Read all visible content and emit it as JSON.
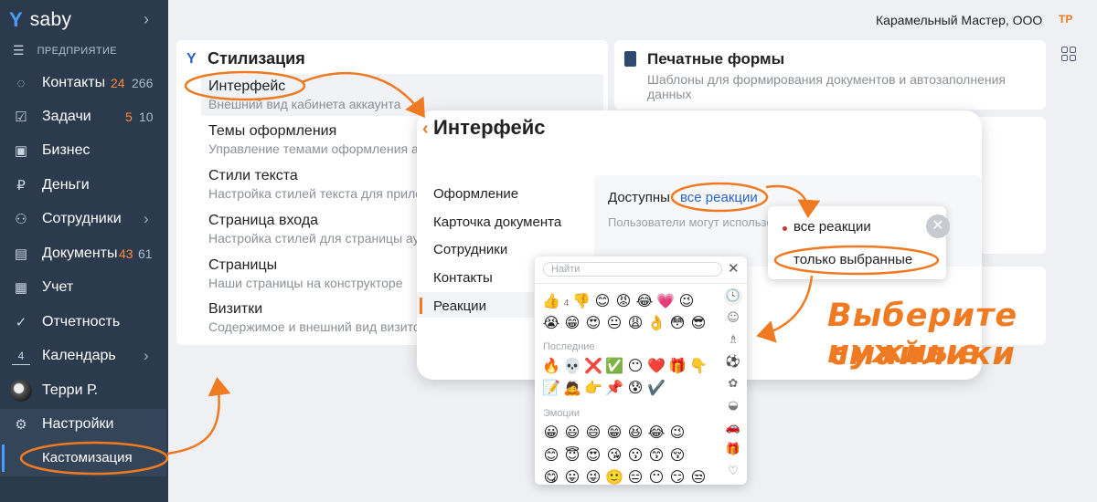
{
  "sidebar": {
    "logo": "saby",
    "section": "ПРЕДПРИЯТИЕ",
    "items": [
      {
        "icon": "contacts-icon",
        "label": "Контакты",
        "count1": "24",
        "count2": "266"
      },
      {
        "icon": "tasks-icon",
        "label": "Задачи",
        "count1": "5",
        "count2": "10"
      },
      {
        "icon": "business-icon",
        "label": "Бизнес"
      },
      {
        "icon": "money-icon",
        "label": "Деньги"
      },
      {
        "icon": "employees-icon",
        "label": "Сотрудники"
      },
      {
        "icon": "documents-icon",
        "label": "Документы",
        "count1": "43",
        "count2": "61"
      },
      {
        "icon": "accounting-icon",
        "label": "Учет"
      },
      {
        "icon": "reports-icon",
        "label": "Отчетность"
      },
      {
        "icon": "calendar-icon",
        "label": "Календарь",
        "day": "4"
      },
      {
        "icon": "avatar",
        "label": "Терри Р."
      },
      {
        "icon": "gear-icon",
        "label": "Настройки"
      }
    ],
    "sub_item": "Кастомизация"
  },
  "header": {
    "company": "Карамельный Мастер, ООО",
    "user_initials": "ТР"
  },
  "styling": {
    "title": "Стилизация",
    "items": [
      {
        "name": "Интерфейс",
        "desc": "Внешний вид кабинета аккаунта"
      },
      {
        "name": "Темы оформления",
        "desc": "Управление темами оформления аккаунта"
      },
      {
        "name": "Стили текста",
        "desc": "Настройка стилей текста для приложений"
      },
      {
        "name": "Страница входа",
        "desc": "Настройка стилей для страницы аутентификации"
      },
      {
        "name": "Страницы",
        "desc": "Наши страницы на конструкторе"
      },
      {
        "name": "Визитки",
        "desc": "Содержимое и внешний вид визиток"
      }
    ]
  },
  "print_forms": {
    "title": "Печатные формы",
    "desc": "Шаблоны для формирования документов и автозаполнения данных"
  },
  "interface_panel": {
    "title": "Интерфейс",
    "nav": [
      "Оформление",
      "Карточка документа",
      "Сотрудники",
      "Контакты",
      "Реакции"
    ],
    "available_label": "Доступны",
    "available_value": "все реакции",
    "users_text": "Пользователи могут использовать"
  },
  "dropdown": {
    "options": [
      "все реакции",
      "только выбранные"
    ]
  },
  "emoji_picker": {
    "search_placeholder": "Найти",
    "top_count": "4",
    "top_rows": [
      [
        "👍",
        "",
        "👎",
        "😊",
        "😡",
        "😂",
        "💗",
        "😉"
      ],
      [
        "😭",
        "😁",
        "😍",
        "😐",
        "😩",
        "👌",
        "😳",
        "😎"
      ]
    ],
    "recent_label": "Последние",
    "recent_rows": [
      [
        "🔥",
        "💀",
        "❌",
        "✅",
        "😶",
        "❤️",
        "🎁",
        "👇"
      ],
      [
        "📝",
        "🙇",
        "👉",
        "📌",
        "😰",
        "✔️"
      ]
    ],
    "emotions_label": "Эмоции",
    "emotion_rows": [
      [
        "😀",
        "😃",
        "😄",
        "😁",
        "😆",
        "😂",
        "😉"
      ],
      [
        "😊",
        "😇",
        "😍",
        "😘",
        "😗",
        "😙",
        "😚"
      ],
      [
        "😋",
        "😛",
        "😜",
        "🙂",
        "😑",
        "😶",
        "😏",
        "😒"
      ]
    ],
    "categories": [
      "🕓",
      "☺",
      "♗",
      "⚽",
      "✿",
      "◒",
      "🚗",
      "🎁",
      "♡"
    ]
  },
  "annotation": {
    "line1": "Выберите нужные",
    "line2": "смайлики"
  }
}
